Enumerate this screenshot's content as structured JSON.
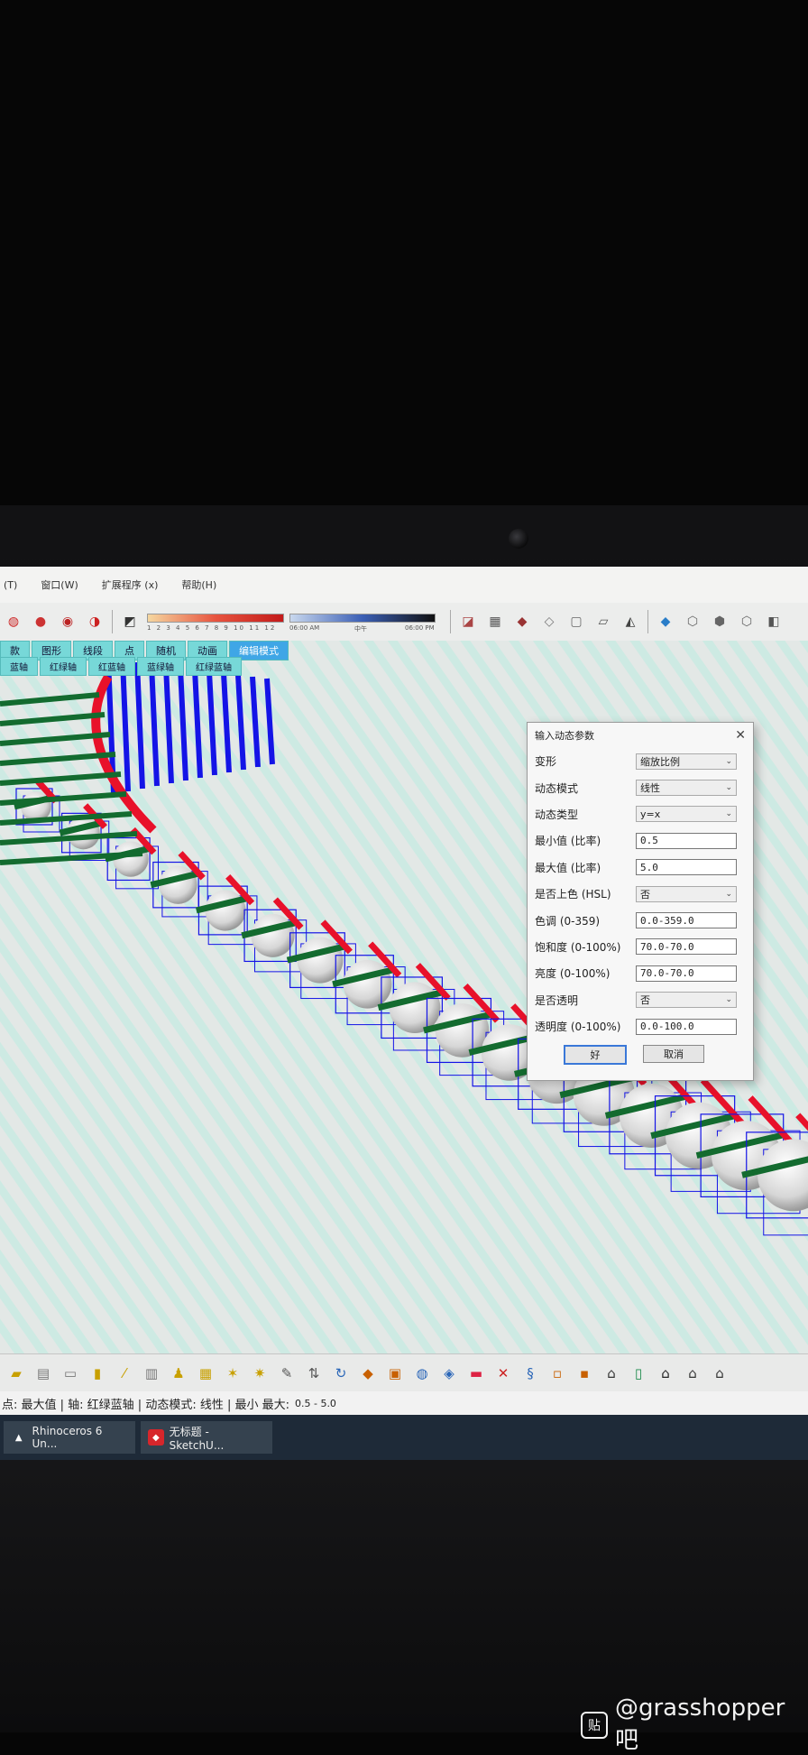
{
  "menu": [
    "(T)",
    "窗口(W)",
    "扩展程序 (x)",
    "帮助(H)"
  ],
  "toolbar": {
    "ticks": "1 2 3 4 5 6 7 8 9 10 11 12",
    "time_start": "06:00 AM",
    "time_mid": "中午",
    "time_end": "06:00 PM"
  },
  "mode_tabs": [
    "款",
    "图形",
    "线段",
    "点",
    "随机",
    "动画",
    "编辑模式"
  ],
  "mode_tabs2": [
    "蓝轴",
    "红绿轴",
    "红蓝轴",
    "蓝绿轴",
    "红绿蓝轴"
  ],
  "dialog": {
    "title": "输入动态参数",
    "fields": [
      {
        "label": "变形",
        "value": "缩放比例",
        "kind": "select"
      },
      {
        "label": "动态模式",
        "value": "线性",
        "kind": "select"
      },
      {
        "label": "动态类型",
        "value": "y=x",
        "kind": "select"
      },
      {
        "label": "最小值 (比率)",
        "value": "0.5",
        "kind": "input"
      },
      {
        "label": "最大值 (比率)",
        "value": "5.0",
        "kind": "input"
      },
      {
        "label": "是否上色 (HSL)",
        "value": "否",
        "kind": "select"
      },
      {
        "label": "色调 (0-359)",
        "value": "0.0-359.0",
        "kind": "input"
      },
      {
        "label": "饱和度 (0-100%)",
        "value": "70.0-70.0",
        "kind": "input"
      },
      {
        "label": "亮度 (0-100%)",
        "value": "70.0-70.0",
        "kind": "input"
      },
      {
        "label": "是否透明",
        "value": "否",
        "kind": "select"
      },
      {
        "label": "透明度 (0-100%)",
        "value": "0.0-100.0",
        "kind": "input"
      }
    ],
    "ok_label": "好",
    "cancel_label": "取消"
  },
  "status": {
    "text": "点: 最大值 | 轴: 红绿蓝轴 | 动态模式: 线性 | 最小 最大:",
    "range": "0.5 - 5.0"
  },
  "taskbar": [
    {
      "label": "Rhinoceros 6 Un...",
      "icon_color": "#ffffff"
    },
    {
      "label": "无标题 - SketchU...",
      "icon_color": "#d7262b"
    }
  ],
  "watermark": {
    "text": "@grasshopper吧",
    "icon": "贴"
  },
  "colors": {
    "red_axis": "#e8112a",
    "green_axis": "#136b2f",
    "blue_axis": "#1414e6"
  }
}
